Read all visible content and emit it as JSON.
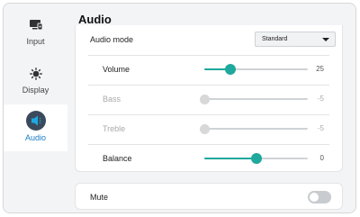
{
  "sidebar": {
    "items": [
      {
        "label": "Input",
        "icon": "input-icon",
        "active": false
      },
      {
        "label": "Display",
        "icon": "brightness-icon",
        "active": false
      },
      {
        "label": "Audio",
        "icon": "speaker-icon",
        "active": true
      }
    ]
  },
  "main": {
    "title": "Audio",
    "audio_mode": {
      "label": "Audio mode",
      "selected": "Standard"
    },
    "sliders": [
      {
        "label": "Volume",
        "value": "25",
        "position": 0.25,
        "enabled": true
      },
      {
        "label": "Bass",
        "value": "-5",
        "position": 0.0,
        "enabled": false
      },
      {
        "label": "Treble",
        "value": "-5",
        "position": 0.0,
        "enabled": false
      },
      {
        "label": "Balance",
        "value": "0",
        "position": 0.5,
        "enabled": true
      }
    ],
    "mute": {
      "label": "Mute",
      "on": false
    }
  },
  "colors": {
    "accent": "#1fa89c",
    "active_label": "#1a7dc4",
    "active_icon_bg": "#3a4a5c"
  }
}
